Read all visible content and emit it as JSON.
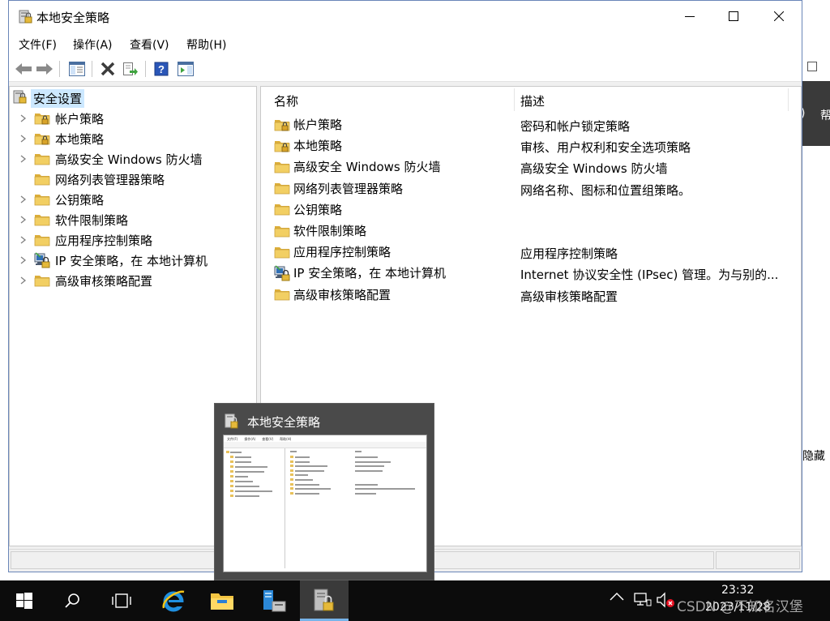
{
  "window": {
    "title": "本地安全策略",
    "controls": {
      "minimize": "minimize",
      "maximize": "maximize",
      "close": "close"
    }
  },
  "menu": [
    "文件(F)",
    "操作(A)",
    "查看(V)",
    "帮助(H)"
  ],
  "toolbar": [
    "back-arrow",
    "forward-arrow",
    "show-hide-console-tree",
    "delete",
    "export-list",
    "help",
    "show-action-pane"
  ],
  "tree": {
    "root": "安全设置",
    "items": [
      {
        "label": "帐户策略",
        "expandable": true,
        "icon": "lock-folder"
      },
      {
        "label": "本地策略",
        "expandable": true,
        "icon": "lock-folder"
      },
      {
        "label": "高级安全 Windows 防火墙",
        "expandable": true,
        "icon": "folder"
      },
      {
        "label": "网络列表管理器策略",
        "expandable": false,
        "icon": "folder"
      },
      {
        "label": "公钥策略",
        "expandable": true,
        "icon": "folder"
      },
      {
        "label": "软件限制策略",
        "expandable": true,
        "icon": "folder"
      },
      {
        "label": "应用程序控制策略",
        "expandable": true,
        "icon": "folder"
      },
      {
        "label": "IP 安全策略，在 本地计算机",
        "expandable": true,
        "icon": "ipsec"
      },
      {
        "label": "高级审核策略配置",
        "expandable": true,
        "icon": "folder"
      }
    ]
  },
  "list": {
    "columns": [
      "名称",
      "描述"
    ],
    "rows": [
      {
        "name": "帐户策略",
        "desc": "密码和帐户锁定策略",
        "icon": "lock-folder"
      },
      {
        "name": "本地策略",
        "desc": "审核、用户权利和安全选项策略",
        "icon": "lock-folder"
      },
      {
        "name": "高级安全 Windows 防火墙",
        "desc": "高级安全 Windows 防火墙",
        "icon": "folder"
      },
      {
        "name": "网络列表管理器策略",
        "desc": "网络名称、图标和位置组策略。",
        "icon": "folder"
      },
      {
        "name": "公钥策略",
        "desc": "",
        "icon": "folder"
      },
      {
        "name": "软件限制策略",
        "desc": "",
        "icon": "folder"
      },
      {
        "name": "应用程序控制策略",
        "desc": "应用程序控制策略",
        "icon": "folder"
      },
      {
        "name": "IP 安全策略，在 本地计算机",
        "desc": "Internet 协议安全性 (IPsec) 管理。为与别的...",
        "icon": "ipsec"
      },
      {
        "name": "高级审核策略配置",
        "desc": "高级审核策略配置",
        "icon": "folder"
      }
    ]
  },
  "preview": {
    "title": "本地安全策略"
  },
  "background_window": {
    "partial_text_1": ")",
    "partial_text_2": "帮",
    "partial_text_3": "隐藏"
  },
  "taskbar": {
    "apps": [
      "start",
      "search",
      "task-view",
      "internet-explorer",
      "file-explorer",
      "server-manager",
      "local-security-policy"
    ],
    "active": "local-security-policy",
    "clock_time": "23:32",
    "clock_date": "2023/11/28",
    "watermark": "CSDN @不知名汉堡"
  },
  "colors": {
    "selection": "#cce8ff",
    "folder": "#e8c15a",
    "taskbar": "#0c0c0c",
    "accent": "#77b4ea"
  }
}
